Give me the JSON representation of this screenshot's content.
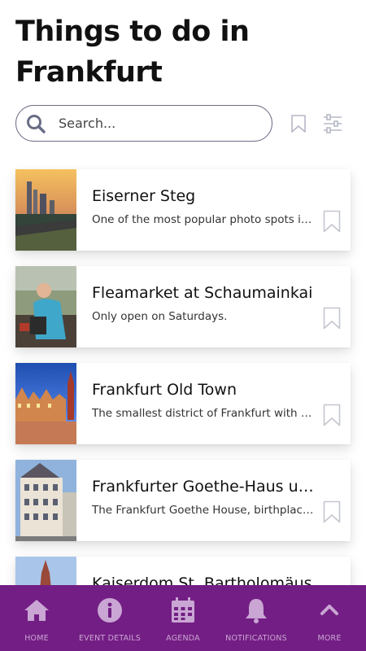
{
  "page": {
    "title": "Things to do in Frankfurt"
  },
  "search": {
    "placeholder": "Search..."
  },
  "items": [
    {
      "title": "Eiserner Steg",
      "description": "One of the most popular photo spots in Frankfurt"
    },
    {
      "title": "Fleamarket at Schaumainkai",
      "description": "Only open on Saturdays."
    },
    {
      "title": "Frankfurt Old Town",
      "description": "The smallest district of Frankfurt with its historic buildings"
    },
    {
      "title": "Frankfurter Goethe-Haus und Goethe-Museum",
      "description": "The Frankfurt Goethe House, birthplace of Johann Wolfgang von Goethe"
    },
    {
      "title": "Kaiserdom St. Bartholomäus",
      "description": ""
    }
  ],
  "bottom_nav": [
    {
      "label": "HOME",
      "icon": "home-icon"
    },
    {
      "label": "EVENT DETAILS",
      "icon": "info-icon"
    },
    {
      "label": "AGENDA",
      "icon": "calendar-icon"
    },
    {
      "label": "NOTIFICATIONS",
      "icon": "bell-icon"
    },
    {
      "label": "MORE",
      "icon": "chevron-up-icon"
    }
  ],
  "colors": {
    "nav_background": "#731e84",
    "nav_icon": "#c9a6d3",
    "text": "#111111"
  }
}
